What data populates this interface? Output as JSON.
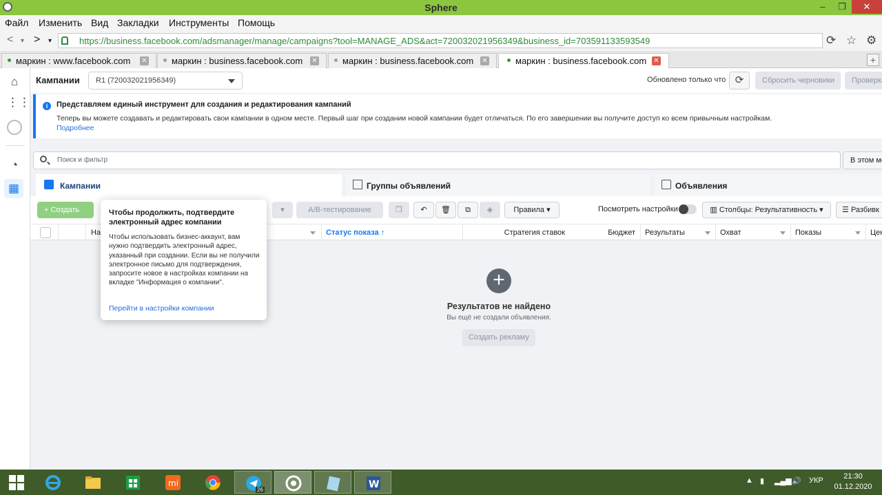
{
  "window": {
    "title": "Sphere",
    "controls": {
      "minimize": "‒",
      "restore": "❐",
      "close": "✕"
    }
  },
  "menu": [
    "Файл",
    "Изменить",
    "Вид",
    "Закладки",
    "Инструменты",
    "Помощь"
  ],
  "address_bar": {
    "url": "https://business.facebook.com/adsmanager/manage/campaigns?tool=MANAGE_ADS&act=720032021956349&business_id=703591133593549"
  },
  "tabs": [
    {
      "label": "маркин : www.facebook.com",
      "active": false
    },
    {
      "label": "маркин : business.facebook.com",
      "active": false
    },
    {
      "label": "маркин : business.facebook.com",
      "active": false
    },
    {
      "label": "маркин : business.facebook.com",
      "active": true
    }
  ],
  "header": {
    "title": "Кампании",
    "account": "R1 (720032021956349)",
    "updated": "Обновлено только что",
    "discard_drafts": "Сбросить черновики",
    "review": "Проверка"
  },
  "banner": {
    "title": "Представляем единый инструмент для создания и редактирования кампаний",
    "text": "Теперь вы можете создавать и редактировать свои кампании в одном месте. Первый шаг при создании новой кампании будет отличаться. По его завершении вы получите доступ ко всем привычным настройкам.",
    "link": "Подробнее"
  },
  "search": {
    "placeholder": "Поиск и фильтр",
    "date_range": "В этом ме"
  },
  "level_tabs": {
    "campaigns": "Кампании",
    "adsets": "Группы объявлений",
    "ads": "Объявления"
  },
  "toolbar": {
    "create": "+ Создать",
    "ab_test": "A/B-тестирование",
    "rules": "Правила",
    "view_settings": "Посмотреть настройки",
    "columns": "Столбцы: Результативность",
    "breakdown": "Разбивк"
  },
  "columns": {
    "name": "На",
    "delivery": "Статус показа",
    "bid_strategy": "Стратегия ставок",
    "budget": "Бюджет",
    "results": "Результаты",
    "reach": "Охват",
    "impressions": "Показы",
    "cost": "Цен"
  },
  "empty": {
    "title": "Результатов не найдено",
    "subtitle": "Вы ещё не создали объявления.",
    "button": "Создать рекламу"
  },
  "popover": {
    "title": "Чтобы продолжить, подтвердите электронный адрес компании",
    "body": "Чтобы использовать бизнес-аккаунт, вам нужно подтвердить электронный адрес, указанный при создании. Если вы не получили электронное письмо для подтверждения, запросите новое в настройках компании на вкладке \"Информация о компании\".",
    "link": "Перейти в настройки компании"
  },
  "taskbar": {
    "apps": [
      "start",
      "internet-explorer",
      "file-explorer",
      "store",
      "xiaomi",
      "chrome",
      "telegram",
      "sphere",
      "notepad",
      "word"
    ],
    "telegram_badge": "26",
    "language": "УКР",
    "time": "21:30",
    "date": "01.12.2020"
  },
  "colors": {
    "titlebar": "#8cc63f",
    "fb_blue": "#1877f2",
    "taskbar": "#3f5b2a"
  }
}
